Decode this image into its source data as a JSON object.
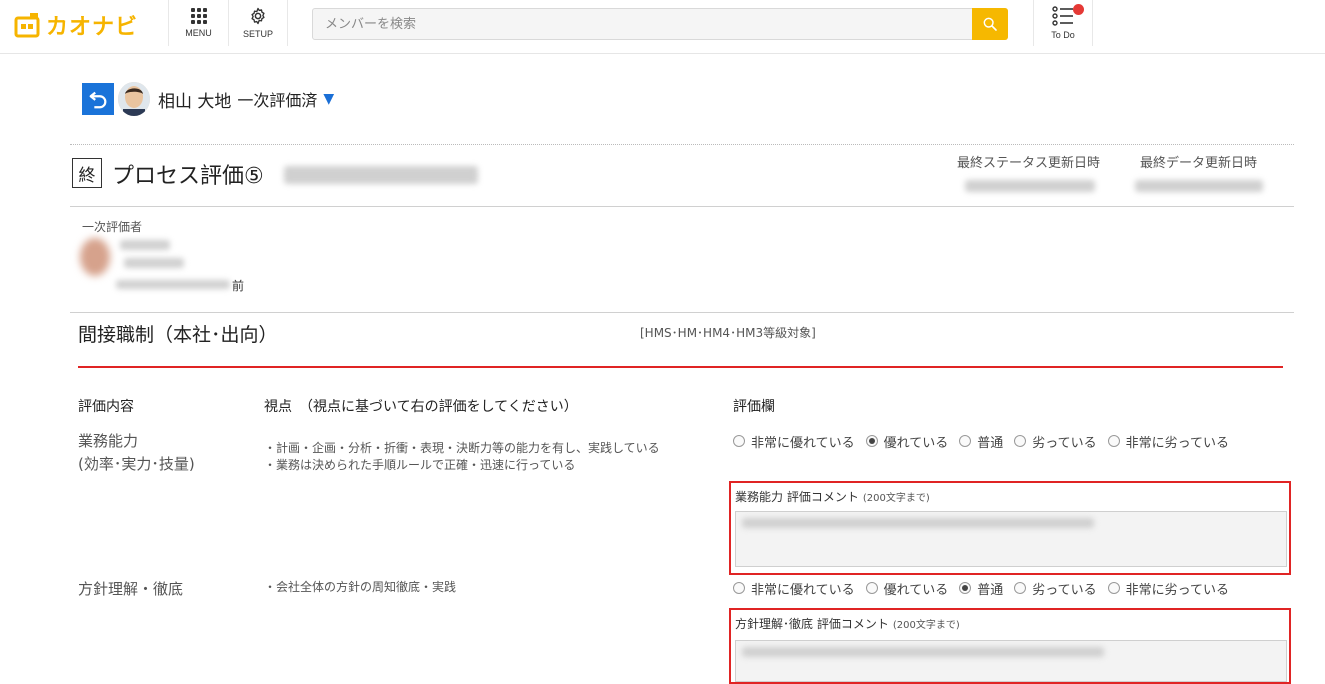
{
  "header": {
    "logo_text": "カオナビ",
    "menu_label": "MENU",
    "setup_label": "SETUP",
    "search_placeholder": "メンバーを検索",
    "todo_label": "To Do"
  },
  "person": {
    "name": "相山 大地",
    "status": "一次評価済"
  },
  "sheet": {
    "final_badge": "終",
    "title": "プロセス評価⑤",
    "last_status_update_label": "最終ステータス更新日時",
    "last_data_update_label": "最終データ更新日時"
  },
  "evaluator": {
    "label": "一次評価者",
    "suffix": "前"
  },
  "section": {
    "title": "間接職制（本社･出向）",
    "target": "[HMS･HM･HM4･HM3等級対象]"
  },
  "columns": {
    "content": "評価内容",
    "viewpoint": "視点　（視点に基づいて右の評価をしてください）",
    "rating": "評価欄"
  },
  "rating_options": [
    "非常に優れている",
    "優れている",
    "普通",
    "劣っている",
    "非常に劣っている"
  ],
  "items": [
    {
      "title_line1": "業務能力",
      "title_line2": "(効率･実力･技量)",
      "desc_line1": "・計画・企画・分析・折衝・表現・決断力等の能力を有し、実践している",
      "desc_line2": "・業務は決められた手順ルールで正確・迅速に行っている",
      "selected": 1,
      "comment_label": "業務能力 評価コメント",
      "comment_limit": "(200文字まで)"
    },
    {
      "title_line1": "方針理解・徹底",
      "desc_line1": "・会社全体の方針の周知徹底・実践",
      "selected": 2,
      "comment_label": "方針理解･徹底 評価コメント",
      "comment_limit": "(200文字まで)"
    }
  ],
  "colors": {
    "accent_yellow": "#f6b800",
    "back_blue": "#1a73d9",
    "highlight_red": "#e02424"
  }
}
